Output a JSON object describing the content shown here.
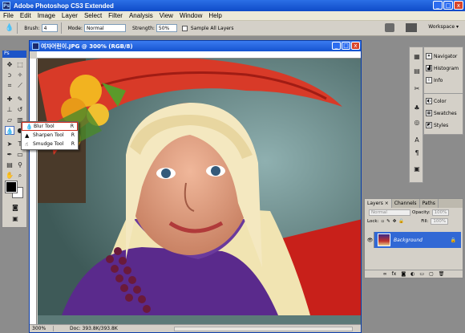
{
  "app": {
    "title": "Adobe Photoshop CS3 Extended",
    "logo": "Ps"
  },
  "window_buttons": {
    "minimize": "_",
    "maximize": "□",
    "close": "x"
  },
  "menu": [
    "File",
    "Edit",
    "Image",
    "Layer",
    "Select",
    "Filter",
    "Analysis",
    "View",
    "Window",
    "Help"
  ],
  "options": {
    "brush_label": "Brush:",
    "brush_size": "4",
    "mode_label": "Mode:",
    "mode_value": "Normal",
    "strength_label": "Strength:",
    "strength_value": "50%",
    "sample_all_layers": "Sample All Layers",
    "workspace": "Workspace ▾"
  },
  "toolbox": {
    "title": "Ps"
  },
  "flyout": {
    "items": [
      {
        "label": "Blur Tool",
        "key": "R",
        "icon": "droplet-icon"
      },
      {
        "label": "Sharpen Tool",
        "key": "R",
        "icon": "triangle-icon"
      },
      {
        "label": "Smudge Tool",
        "key": "R",
        "icon": "finger-icon"
      }
    ]
  },
  "document": {
    "title": "여자어린이.JPG @ 300% (RGB/8)",
    "zoom": "300%",
    "doc_info": "Doc: 393.8K/393.8K"
  },
  "side_panels": {
    "group1": [
      "Navigator",
      "Histogram",
      "Info"
    ],
    "group2": [
      "Color",
      "Swatches",
      "Styles"
    ]
  },
  "layers_panel": {
    "tabs": [
      "Layers ×",
      "Channels",
      "Paths"
    ],
    "blend_mode": "Normal",
    "opacity_label": "Opacity:",
    "opacity_value": "100%",
    "lock_label": "Lock:",
    "fill_label": "Fill:",
    "fill_value": "100%",
    "layer_name": "Background"
  }
}
